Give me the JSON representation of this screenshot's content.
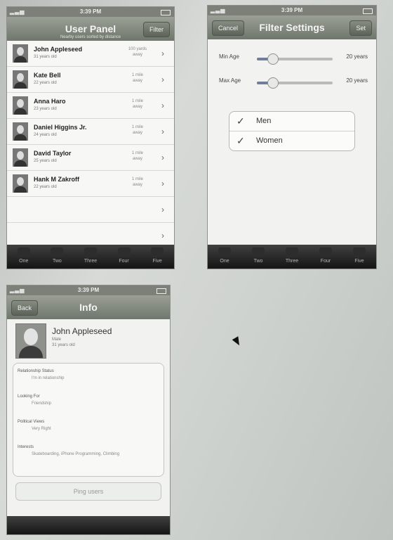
{
  "left_phone": {
    "status_time": "3:39 PM",
    "nav_title": "User Panel",
    "nav_subtitle": "Nearby users sorted by distance",
    "nav_button": "Filter",
    "users": [
      {
        "name": "John Appleseed",
        "age": "31 years old",
        "distance": "100 yards away"
      },
      {
        "name": "Kate Bell",
        "age": "22 years old",
        "distance": "1 mile away"
      },
      {
        "name": "Anna Haro",
        "age": "23 years old",
        "distance": "1 mile away"
      },
      {
        "name": "Daniel Higgins Jr.",
        "age": "24 years old",
        "distance": "1 mile away"
      },
      {
        "name": "David Taylor",
        "age": "25 years old",
        "distance": "1 mile away"
      },
      {
        "name": "Hank M Zakroff",
        "age": "22 years old",
        "distance": "1 mile away"
      }
    ],
    "tabs": [
      "One",
      "Two",
      "Three",
      "Four",
      "Five"
    ]
  },
  "right_phone": {
    "status_time": "3:39 PM",
    "nav_title": "Filter Settings",
    "cancel_button": "Cancel",
    "set_button": "Set",
    "min_age_label": "Min Age",
    "min_age_value": "20 years",
    "max_age_label": "Max Age",
    "max_age_value": "20 years",
    "min_age_level": 0.2,
    "max_age_level": 0.2,
    "options": [
      {
        "label": "Men",
        "checked": true
      },
      {
        "label": "Women",
        "checked": true
      }
    ],
    "tabs": [
      "One",
      "Two",
      "Three",
      "Four",
      "Five"
    ]
  },
  "bottom_phone": {
    "status_time": "3:39 PM",
    "back_button": "Back",
    "nav_title": "Info",
    "profile_name": "John Appleseed",
    "profile_sub1": "Male",
    "profile_sub2": "31 years old",
    "fields": [
      {
        "label": "Relationship Status",
        "value": "I'm in relationship"
      },
      {
        "label": "Looking For",
        "value": "Friendship"
      },
      {
        "label": "Political Views",
        "value": "Very Right"
      },
      {
        "label": "Interests",
        "value": "Skateboarding, iPhone Programming, Climbing"
      }
    ],
    "ping_button": "Ping users"
  }
}
